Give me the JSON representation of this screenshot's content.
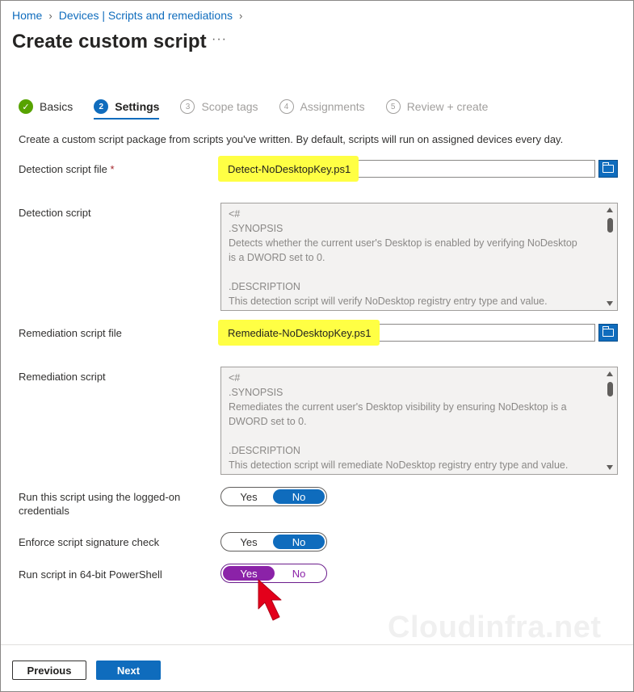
{
  "breadcrumb": {
    "home": "Home",
    "devices": "Devices | Scripts and remediations"
  },
  "page": {
    "title": "Create custom script",
    "more": "···"
  },
  "steps": [
    {
      "num": "✓",
      "label": "Basics",
      "state": "done"
    },
    {
      "num": "2",
      "label": "Settings",
      "state": "active"
    },
    {
      "num": "3",
      "label": "Scope tags",
      "state": "future"
    },
    {
      "num": "4",
      "label": "Assignments",
      "state": "future"
    },
    {
      "num": "5",
      "label": "Review + create",
      "state": "future"
    }
  ],
  "intro": "Create a custom script package from scripts you've written. By default, scripts will run on assigned devices every day.",
  "fields": {
    "detection_file_label": "Detection script file",
    "detection_file_required": "*",
    "detection_file_value": "Detect-NoDesktopKey.ps1",
    "detection_script_label": "Detection script",
    "detection_script_text": "<#\n.SYNOPSIS\nDetects whether the current user's Desktop is enabled by verifying NoDesktop\nis a DWORD set to 0.\n\n.DESCRIPTION\nThis detection script will verify NoDesktop registry entry type and value.",
    "remediation_file_label": "Remediation script file",
    "remediation_file_value": "Remediate-NoDesktopKey.ps1",
    "remediation_script_label": "Remediation script",
    "remediation_script_text": "<#\n.SYNOPSIS\nRemediates the current user's Desktop visibility by ensuring NoDesktop is a\nDWORD set to 0.\n\n.DESCRIPTION\nThis detection script will remediate NoDesktop registry entry type and value.",
    "logged_on_label": "Run this script using the logged-on credentials",
    "signature_label": "Enforce script signature check",
    "powershell64_label": "Run script in 64-bit PowerShell"
  },
  "toggles": {
    "yes": "Yes",
    "no": "No",
    "logged_on_selected": "No",
    "signature_selected": "No",
    "powershell64_selected": "Yes"
  },
  "watermark": "Cloudinfra.net",
  "footer": {
    "previous": "Previous",
    "next": "Next"
  },
  "colors": {
    "accent": "#0f6cbd",
    "highlight": "#ffff44",
    "selected_purple": "#8b22a8",
    "arrow_red": "#e3001b",
    "step_done": "#57a300"
  }
}
